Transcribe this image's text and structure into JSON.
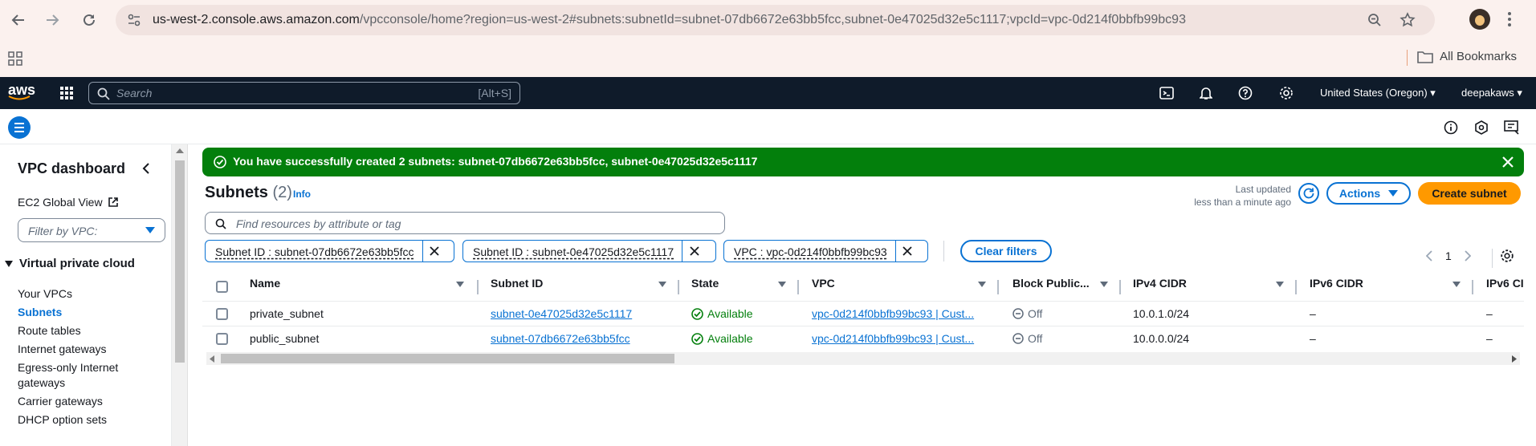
{
  "browser": {
    "url_host": "us-west-2.console.aws.amazon.com",
    "url_path": "/vpcconsole/home?region=us-west-2#subnets:subnetId=subnet-07db6672e63bb5fcc,subnet-0e47025d32e5c1117;vpcId=vpc-0d214f0bbfb99bc93",
    "bookmarks_label": "All Bookmarks"
  },
  "aws_nav": {
    "logo": "aws",
    "search_placeholder": "Search",
    "search_shortcut": "[Alt+S]",
    "region": "United States (Oregon)",
    "user": "deepakaws"
  },
  "sidebar": {
    "title": "VPC dashboard",
    "ec2_global_view": "EC2 Global View",
    "filter_placeholder": "Filter by VPC:",
    "section": "Virtual private cloud",
    "items": [
      {
        "label": "Your VPCs"
      },
      {
        "label": "Subnets"
      },
      {
        "label": "Route tables"
      },
      {
        "label": "Internet gateways"
      },
      {
        "label": "Egress-only Internet"
      },
      {
        "label": "gateways"
      },
      {
        "label": "Carrier gateways"
      },
      {
        "label": "DHCP option sets"
      }
    ]
  },
  "flash": {
    "message": "You have successfully created 2 subnets: subnet-07db6672e63bb5fcc, subnet-0e47025d32e5c1117"
  },
  "header": {
    "title": "Subnets",
    "count": "(2)",
    "info": "Info",
    "last_updated_label": "Last updated",
    "last_updated_value": "less than a minute ago",
    "actions_label": "Actions",
    "create_label": "Create subnet"
  },
  "filter": {
    "placeholder": "Find resources by attribute or tag",
    "tokens": [
      {
        "label": "Subnet ID : subnet-07db6672e63bb5fcc"
      },
      {
        "label": "Subnet ID : subnet-0e47025d32e5c1117"
      },
      {
        "label": "VPC : vpc-0d214f0bbfb99bc93"
      }
    ],
    "clear_label": "Clear filters"
  },
  "pagination": {
    "current_page": "1"
  },
  "table": {
    "columns": [
      "Name",
      "Subnet ID",
      "State",
      "VPC",
      "Block Public...",
      "IPv4 CIDR",
      "IPv6 CIDR",
      "IPv6 CI"
    ],
    "rows": [
      {
        "name": "private_subnet",
        "subnet_id": "subnet-0e47025d32e5c1117",
        "state": "Available",
        "vpc": "vpc-0d214f0bbfb99bc93 | Cust...",
        "block": "Off",
        "ipv4": "10.0.1.0/24",
        "ipv6": "–",
        "ipv6b": "–"
      },
      {
        "name": "public_subnet",
        "subnet_id": "subnet-07db6672e63bb5fcc",
        "state": "Available",
        "vpc": "vpc-0d214f0bbfb99bc93 | Cust...",
        "block": "Off",
        "ipv4": "10.0.0.0/24",
        "ipv6": "–",
        "ipv6b": "–"
      }
    ]
  },
  "colors": {
    "aws_nav_bg": "#0f1b2a",
    "success_green": "#037f0c",
    "link_blue": "#0972d3",
    "primary_orange": "#ff9900"
  }
}
